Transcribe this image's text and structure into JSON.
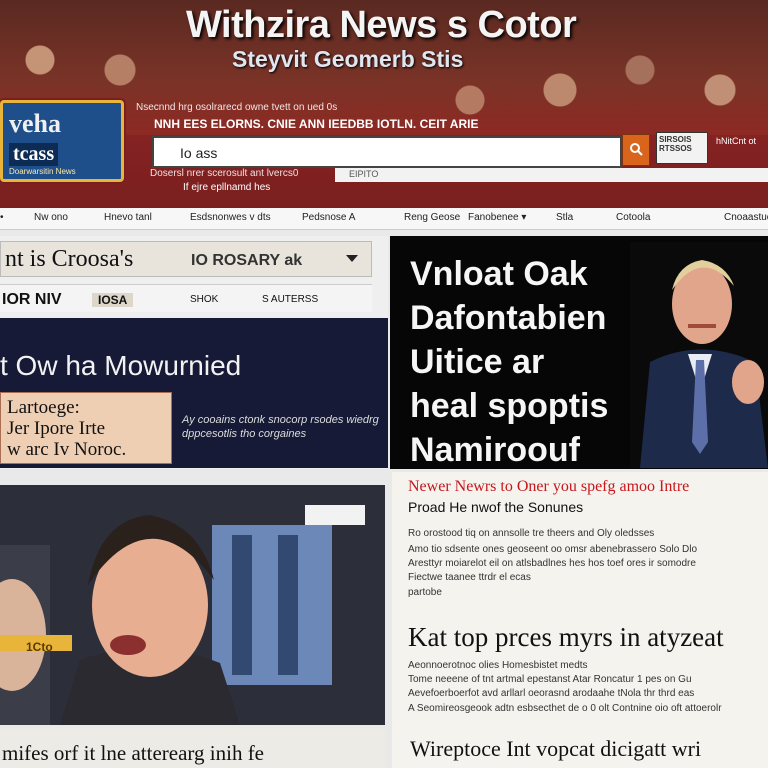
{
  "header": {
    "title": "Withzira News s Cotor",
    "subtitle": "Steyvit Geomerb Stis",
    "logo": {
      "line1": "veha",
      "line2": "tcass",
      "line3": "Doarwarsitin News"
    },
    "tagline1": "Nsecnnd hrg osolrarecd owne tvett on ued 0s",
    "tagline2": "NNH EES ELORNS. CNIE ANN IEEDBB IOTLN. CEIT ARIE",
    "tagline3": "Dosersl nrer scerosult ant lvercs0",
    "tagline4": "If ejre epllnamd hes",
    "search": {
      "value": "Io ass",
      "placeholder": "Search"
    },
    "badge": "SIRSOIS RTSSOS",
    "corner_link": "hNitCnt ot",
    "strip_text": "EIPITO"
  },
  "nav": {
    "items": [
      "Nw ono",
      "Hnevo tanl",
      "Esdsnonwes v dts",
      "Pedsnose A",
      "Reng Geose",
      "Fanobenee ▾",
      "Stla",
      "Cotoola",
      "Cnoaastuos"
    ]
  },
  "left_top": {
    "headline": "nt is Croosa's",
    "headline_tail": "IO ROSARY ak",
    "tabs": [
      "IOR NIV",
      "IOSA",
      "SHOK",
      "S AUTERSS"
    ],
    "dark_headline": "t Ow ha Mowurnied",
    "inset_text": "Lartoege:\nJer Ipore Irte\nw arc Iv Noroc.",
    "blurb": "Ay cooains ctonk snocorp rsodes wiedrg dppcesotlis tho corgaines"
  },
  "right_top": {
    "headline_lines": [
      "Vnloat Oak",
      "Dafontabien",
      "Uitice ar",
      "heal spoptis",
      "Namiroouf Catt"
    ]
  },
  "bottom_left": {
    "caption_badge": "1Cto",
    "footer_headline": "mifes orf it lne atterearg inih fe"
  },
  "bottom_right": {
    "red_headline": "Newer Newrs to Oner you spefg amoo Intre",
    "sub_headline": "Proad He nwof the Sonunes",
    "body_block1": [
      "Ro orostood tiq on annsolle tre theers and Oly oledsses",
      "Amo tio sdsente ones geoseent oo omsr abenebrassero Solo Dlo",
      "Aresttyr moiarelot eil on atlsbadlnes hes hos toef ores ir somodre",
      "Fiectwe taanee ttrdr el ecas",
      "partobe"
    ],
    "big_headline": "Kat top prces myrs in atyzeat",
    "body_block2": [
      "Aeonnoerotnoc olies Homesbistet medts",
      "Tome neeene of tnt artmal epestanst Atar Roncatur 1 pes on Gu",
      "Aevefoerboerfot avd arllarl oeorasnd arodaahe tNola thr thrd eas",
      "A Seomireosgeook adtn esbsecthet de o 0 olt Contnine oio oft attoerolr"
    ],
    "bottom_headline": "Wireptoce Int vopcat dicigatt wri"
  }
}
